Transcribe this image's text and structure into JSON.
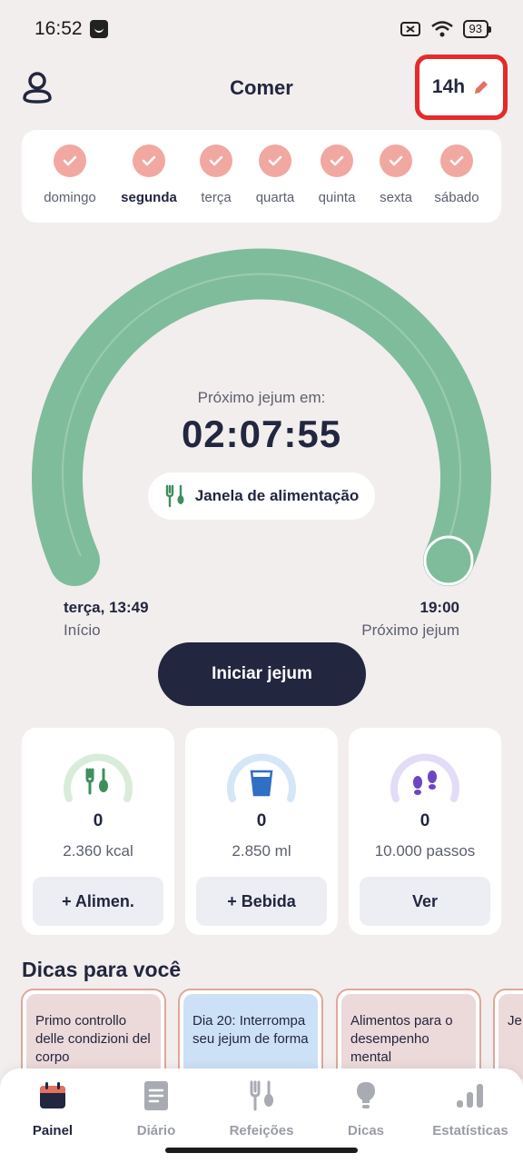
{
  "status": {
    "time": "16:52",
    "battery": "93"
  },
  "header": {
    "title": "Comer",
    "fast_hours": "14h"
  },
  "week": [
    {
      "label": "domingo",
      "done": true
    },
    {
      "label": "segunda",
      "done": true,
      "current": true
    },
    {
      "label": "terça",
      "done": true
    },
    {
      "label": "quarta",
      "done": true
    },
    {
      "label": "quinta",
      "done": true
    },
    {
      "label": "sexta",
      "done": true
    },
    {
      "label": "sábado",
      "done": true
    }
  ],
  "timer": {
    "next_label": "Próximo jejum em:",
    "countdown": "02:07:55",
    "window_label": "Janela de alimentação",
    "start_value": "terça, 13:49",
    "start_label": "Início",
    "end_value": "19:00",
    "end_label": "Próximo jejum",
    "progress": 1.0
  },
  "start_button": "Iniciar jejum",
  "stats": [
    {
      "count": "0",
      "goal": "2.360 kcal",
      "button": "+ Alimen.",
      "icon": "utensils-icon",
      "color": "#3f8f5e",
      "ring": "#d9ecd9"
    },
    {
      "count": "0",
      "goal": "2.850 ml",
      "button": "+ Bebida",
      "icon": "water-glass-icon",
      "color": "#2f6fc4",
      "ring": "#d5e6f7"
    },
    {
      "count": "0",
      "goal": "10.000 passos",
      "button": "Ver",
      "icon": "footsteps-icon",
      "color": "#6b45c4",
      "ring": "#e3dcf7"
    }
  ],
  "tips": {
    "title": "Dicas para você",
    "items": [
      {
        "text": "Primo controllo delle condizioni del corpo"
      },
      {
        "text": "Dia 20: Interrompa seu jejum de forma"
      },
      {
        "text": "Alimentos para o desempenho mental"
      },
      {
        "text": "Je dia"
      }
    ]
  },
  "nav": [
    {
      "label": "Painel",
      "icon": "calendar-icon",
      "active": true
    },
    {
      "label": "Diário",
      "icon": "diary-icon"
    },
    {
      "label": "Refeições",
      "icon": "meals-icon"
    },
    {
      "label": "Dicas",
      "icon": "bulb-icon"
    },
    {
      "label": "Estatísticas",
      "icon": "stats-icon"
    }
  ],
  "colors": {
    "accent": "#22263f",
    "gauge": "#7fbc9c",
    "check": "#f1a8a0",
    "highlight": "#e62a2a"
  }
}
